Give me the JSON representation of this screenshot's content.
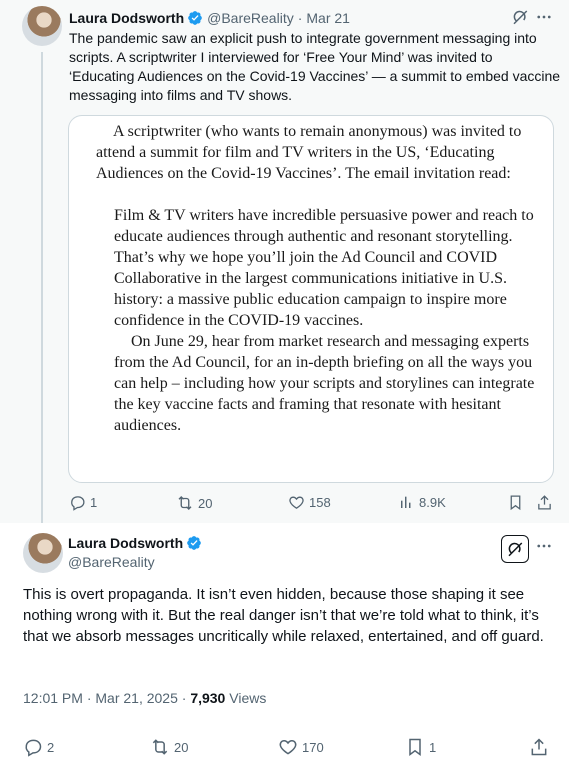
{
  "tweet1": {
    "author_name": "Laura Dodsworth",
    "handle": "@BareReality",
    "separator": "·",
    "date": "Mar 21",
    "text": "The pandemic saw an explicit push to integrate government messaging into scripts. A scriptwriter I interviewed for ‘Free Your Mind’ was invited to ‘Educating Audiences on the Covid-19 Vaccines’ — a summit to embed vaccine messaging into films and TV shows.",
    "image_text": {
      "para1": "A scriptwriter (who wants to remain anonymous) was invited to attend a summit for film and TV writers in the US, ‘Educating Audiences on the Covid-19 Vaccines’. The email invitation read:",
      "para2": "Film & TV writers have incredible persuasive power and reach to educate audiences through authentic and resonant storytelling. That’s why we hope you’ll join the Ad Council and COVID Collaborative in the largest communications initiative in U.S. history: a massive public education campaign to inspire more confidence in the COVID-19 vaccines.",
      "para3": "On June 29, hear from market research and messaging experts from the Ad Council, for an in-depth briefing on all the ways you can help – including how your scripts and storylines can integrate the key vaccine facts and framing that resonate with hesitant audiences."
    },
    "actions": {
      "replies": "1",
      "reposts": "20",
      "likes": "158",
      "views": "8.9K"
    }
  },
  "tweet2": {
    "author_name": "Laura Dodsworth",
    "handle": "@BareReality",
    "text": "This is overt propaganda. It isn’t even hidden, because those shaping it see nothing wrong with it. But the real danger isn’t that we’re told what to think, it’s that we absorb messages uncritically while relaxed, entertained, and off guard.",
    "time": "12:01 PM · Mar 21, 2025 · ",
    "views_count": "7,930",
    "views_label": " Views",
    "actions": {
      "replies": "2",
      "reposts": "20",
      "likes": "170",
      "bookmarks": "1"
    }
  },
  "colors": {
    "verified": "#1d9bf0",
    "muted": "#536471",
    "thread_bg": "#f7f9f9",
    "border": "#cfd9de"
  },
  "icons": [
    "verified-badge-icon",
    "grok-icon",
    "more-icon",
    "reply-icon",
    "repost-icon",
    "like-icon",
    "views-icon",
    "bookmark-icon",
    "share-icon"
  ]
}
